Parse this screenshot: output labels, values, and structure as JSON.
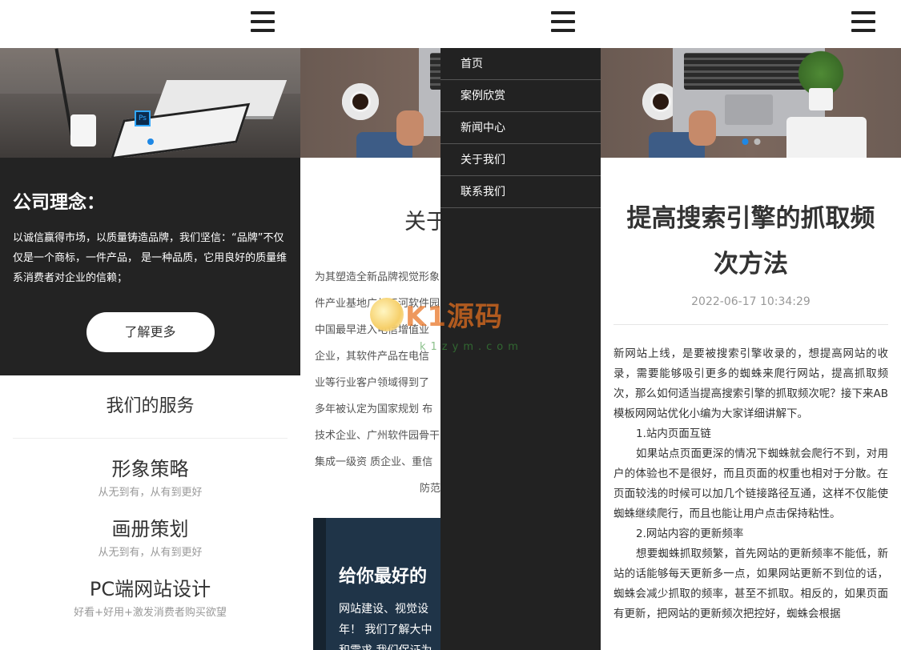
{
  "panel1": {
    "concept_title": "公司理念：",
    "concept_text": "以诚信赢得市场，以质量铸造品牌，我们坚信：“品牌”不仅仅是一个商标，一件产品， 是一种品质，它用良好的质量维系消费者对企业的信赖；",
    "more_button": "了解更多",
    "services_title": "我们的服务",
    "services": [
      {
        "title": "形象策略",
        "subtitle": "从无到有，从有到更好"
      },
      {
        "title": "画册策划",
        "subtitle": "从无到有，从有到更好"
      },
      {
        "title": "PC端网站设计",
        "subtitle": "好看+好用+激发消费者购买欲望"
      }
    ]
  },
  "panel2": {
    "about_title": "关于",
    "about_lines": [
      "为其塑造全新品牌视觉形象",
      "件产业基地广州天河软件园",
      "中国最早进入电信增值业",
      "企业，其软件产品在电信",
      "业等行业客户领域得到了",
      "多年被认定为国家规划 布",
      "技术企业、广州软件园骨干",
      "集成一级资 质企业、重信",
      "防范"
    ],
    "best_title": "给你最好的",
    "best_lines": [
      "网站建设、视觉设",
      "年！ 我们了解大中",
      "和需求,我们保证为"
    ]
  },
  "menu": {
    "items": [
      "首页",
      "案例欣赏",
      "新闻中心",
      "关于我们",
      "联系我们"
    ]
  },
  "watermark": {
    "text": "K1源码",
    "sub": "k1zym.com"
  },
  "panel3": {
    "title": "提高搜索引擎的抓取频次方法",
    "date": "2022-06-17 10:34:29",
    "paragraphs": [
      "新网站上线，是要被搜索引擎收录的，想提高网站的收录，需要能够吸引更多的蜘蛛来爬行网站，提高抓取频次，那么如何适当提高搜索引擎的抓取频次呢？接下来AB模板网网站优化小编为大家详细讲解下。",
      "1.站内页面互链",
      "如果站点页面更深的情况下蜘蛛就会爬行不到，对用户的体验也不是很好，而且页面的权重也相对于分散。在页面较浅的时候可以加几个链接路径互通，这样不仅能使蜘蛛继续爬行，而且也能让用户点击保持粘性。",
      "2.网站内容的更新频率",
      "想要蜘蛛抓取频繁，首先网站的更新频率不能低，新站的话能够每天更新多一点，如果网站更新不到位的话，蜘蛛会减少抓取的频率，甚至不抓取。相反的，如果页面有更新，把网站的更新频次把控好，蜘蛛会根据"
    ]
  },
  "colors": {
    "dark_bg": "#232323",
    "menu_bg": "#222222",
    "accent_dot": "#1e88e5",
    "card_bg": "#1f3448"
  }
}
